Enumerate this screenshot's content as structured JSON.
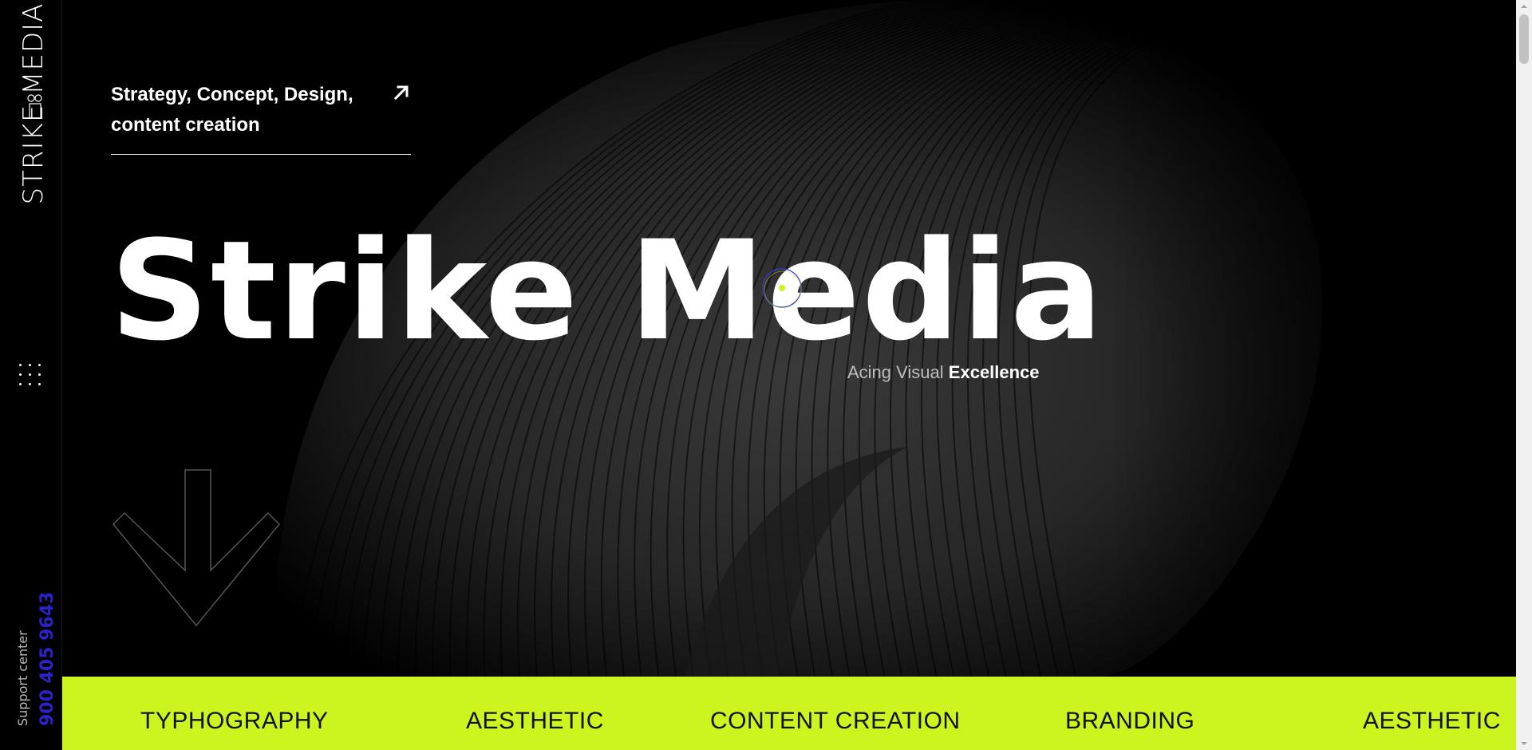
{
  "brand": {
    "logo_text": "STRIKE MEDIA"
  },
  "services_link": {
    "text": "Strategy, Concept, Design, content creation",
    "icon": "arrow-up-right-icon"
  },
  "hero": {
    "title": "Strike Media",
    "tagline_light": "Acing Visual",
    "tagline_bold": "Excellence"
  },
  "support": {
    "label": "Support center",
    "phone": "900 405 9643"
  },
  "marquee": {
    "items": [
      "TYPHOGRAPHY",
      "AESTHETIC",
      "CONTENT CREATION",
      "BRANDING",
      "AESTHETIC"
    ]
  },
  "colors": {
    "background": "#000000",
    "accent": "#ccf51f",
    "phone": "#2b23c8",
    "text": "#ffffff"
  },
  "icons": {
    "menu": "grid-dots-icon",
    "down": "arrow-down-icon",
    "cursor": "cursor-ring-icon"
  }
}
